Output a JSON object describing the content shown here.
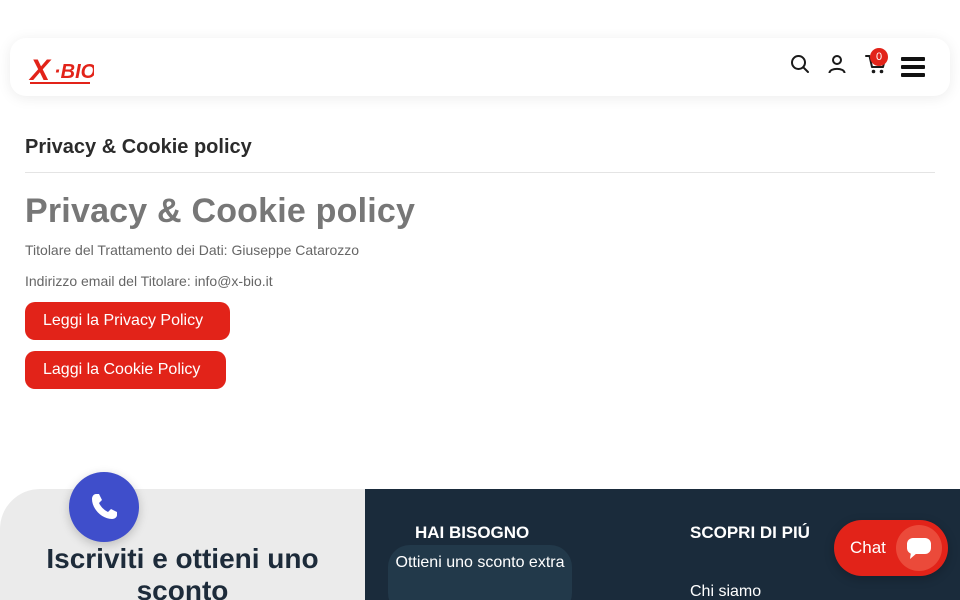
{
  "header": {
    "logo_text": "X·BIO",
    "cart_count": "0"
  },
  "page": {
    "breadcrumb_title": "Privacy & Cookie policy",
    "title": "Privacy & Cookie policy",
    "owner_line": "Titolare del Trattamento dei Dati: Giuseppe Catarozzo",
    "email_line": "Indirizzo email del Titolare: info@x-bio.it",
    "privacy_button": "Leggi la Privacy Policy",
    "cookie_button": "Laggi la Cookie Policy"
  },
  "footer": {
    "subscribe_title": "Iscriviti e ottieni uno sconto",
    "help_heading": "HAI BISOGNO",
    "discount_text": "Ottieni uno sconto extra",
    "discover_heading": "SCOPRI DI PIÚ",
    "about_link": "Chi siamo"
  },
  "chat": {
    "label": "Chat"
  },
  "icons": {
    "search": "search-icon",
    "user": "user-icon",
    "cart": "cart-icon",
    "menu": "hamburger-menu-icon",
    "phone": "phone-icon",
    "chat": "chat-bubble-icon"
  },
  "colors": {
    "accent_red": "#e22319",
    "footer_dark": "#1a2b3b",
    "phone_blue": "#3f4ecb"
  }
}
